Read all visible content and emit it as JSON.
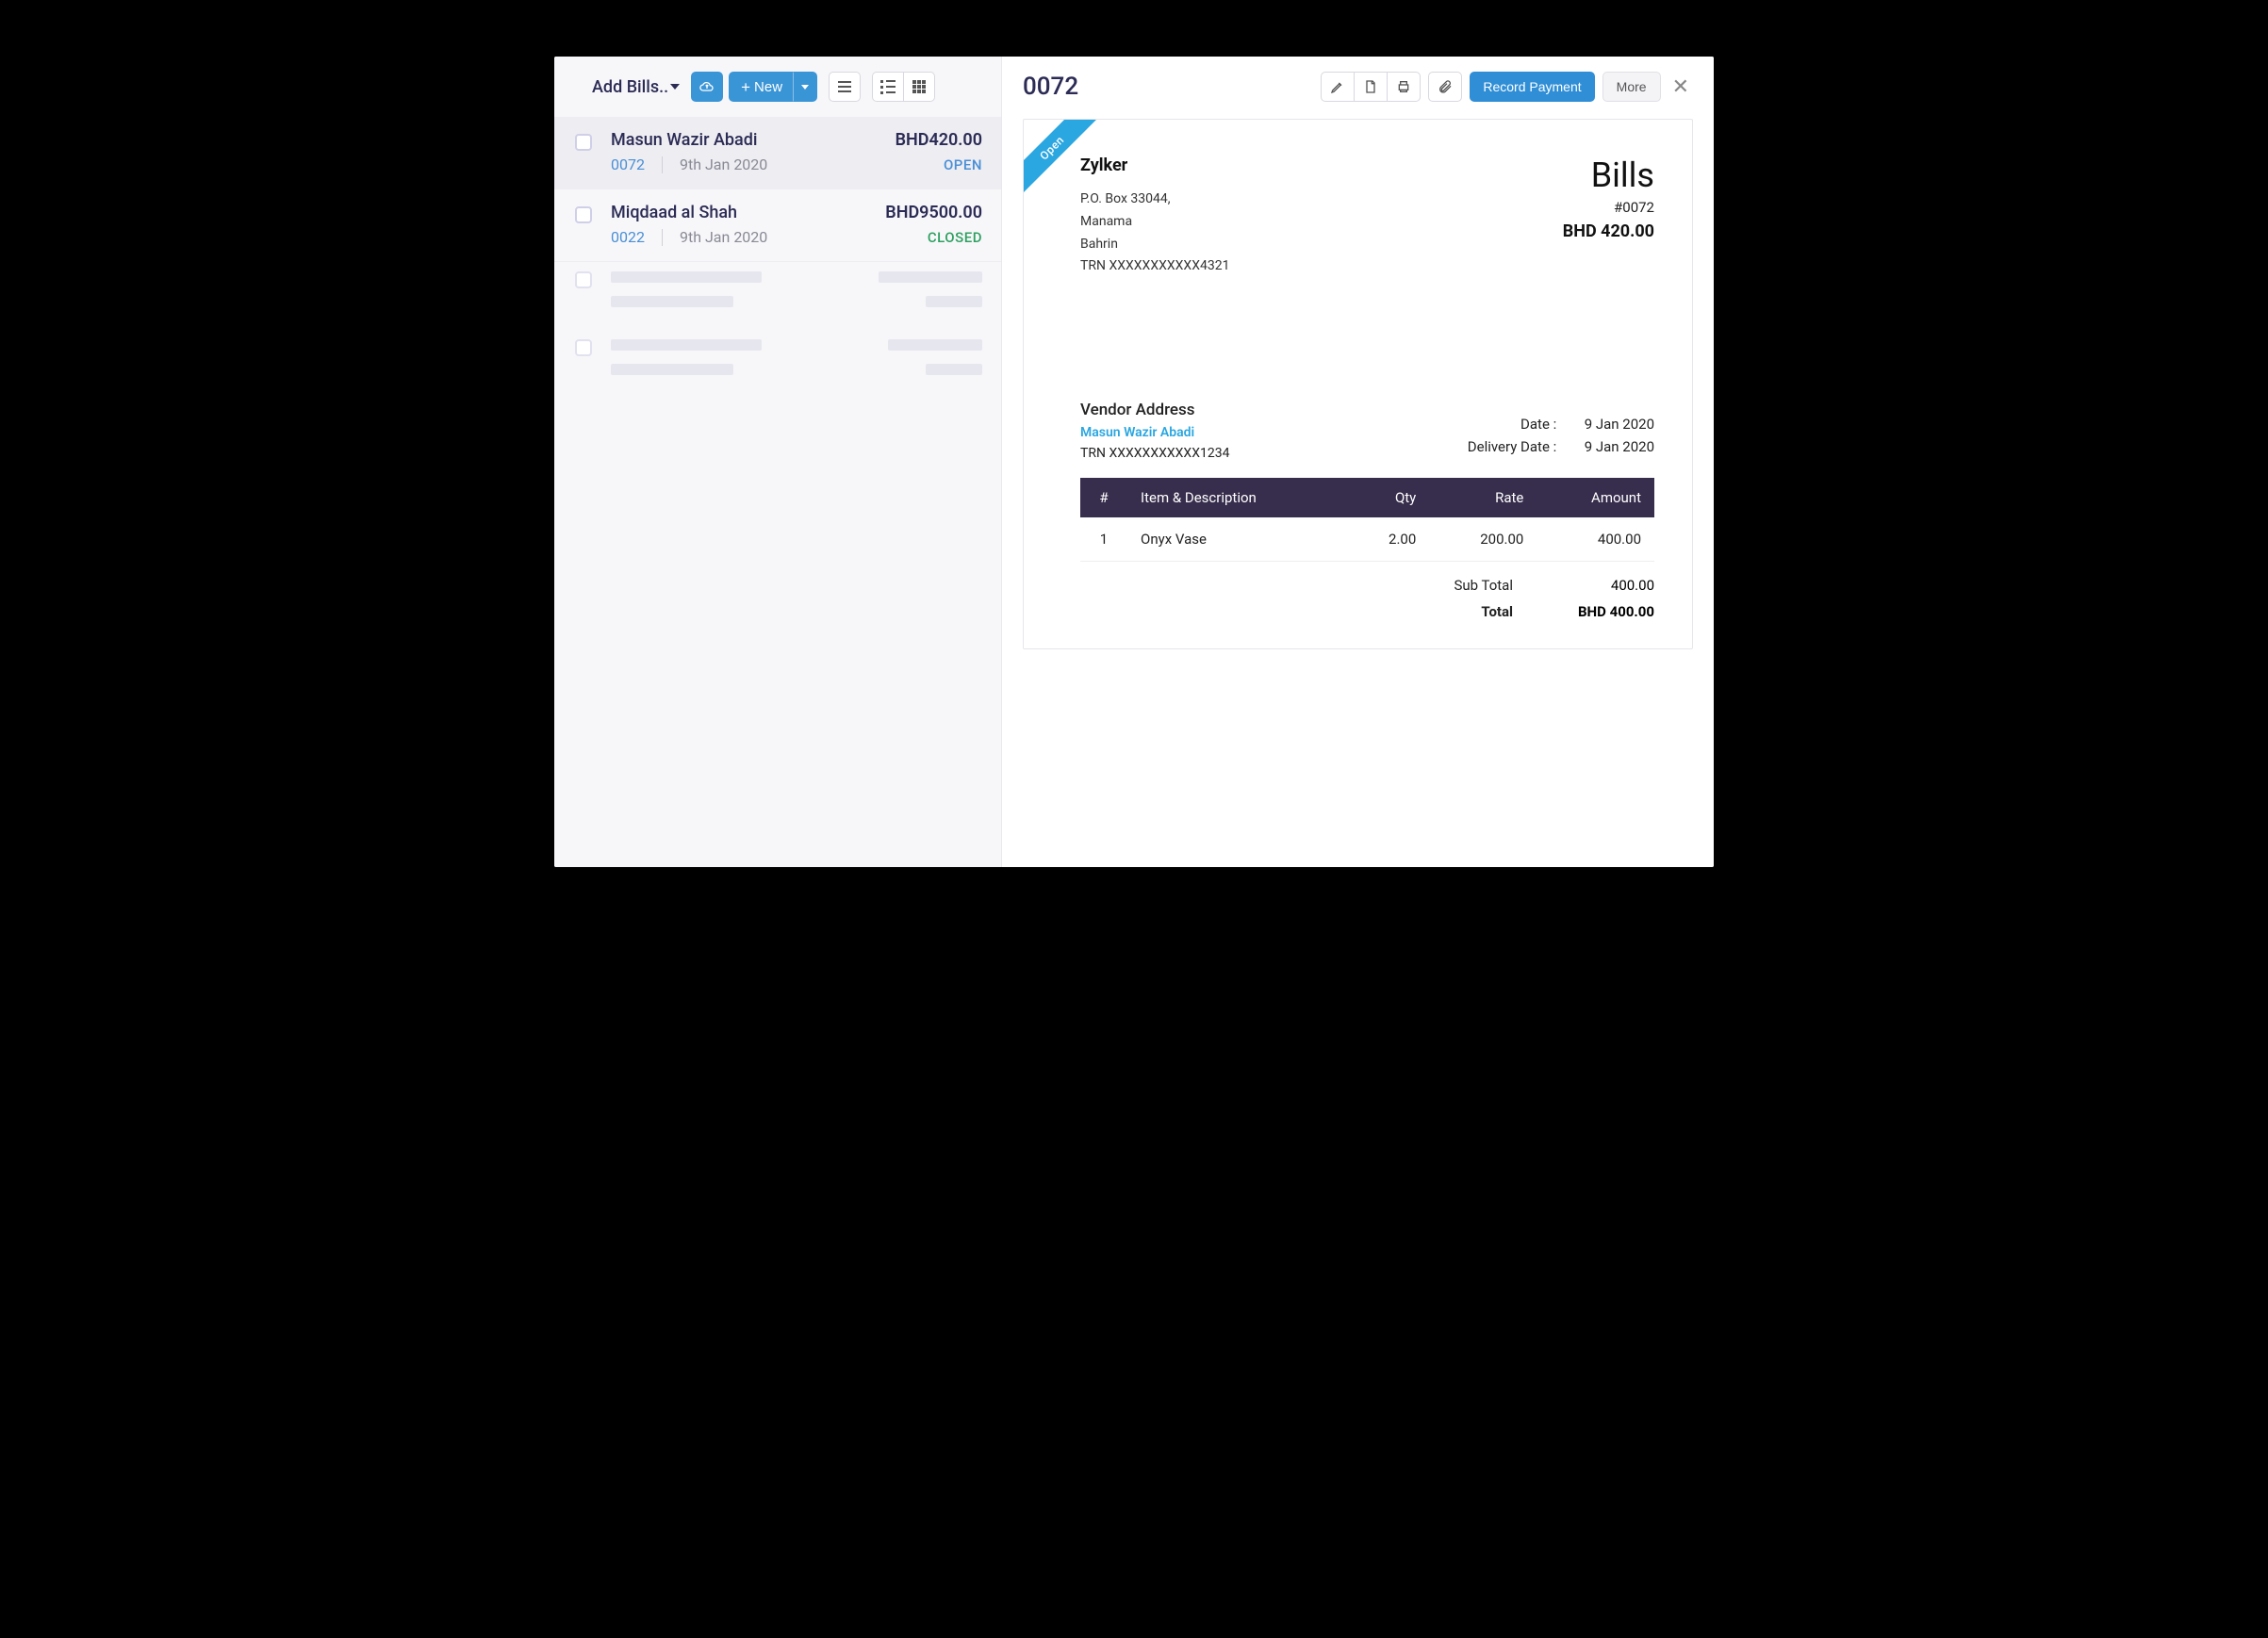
{
  "left": {
    "dropdown_label": "Add Bills..",
    "new_label": "New",
    "items": [
      {
        "name": "Masun Wazir Abadi",
        "amount": "BHD420.00",
        "bill_no": "0072",
        "date": "9th Jan 2020",
        "status": "OPEN",
        "status_class": "open"
      },
      {
        "name": "Miqdaad al Shah",
        "amount": "BHD9500.00",
        "bill_no": "0022",
        "date": "9th Jan 2020",
        "status": "CLOSED",
        "status_class": "closed"
      }
    ]
  },
  "right": {
    "title": "0072",
    "record_payment": "Record Payment",
    "more_label": "More"
  },
  "doc": {
    "ribbon": "Open",
    "company": "Zylker",
    "addr1": "P.O. Box 33044,",
    "addr2": "Manama",
    "addr3": "Bahrin",
    "trn": "TRN XXXXXXXXXXX4321",
    "bills_label": "Bills",
    "bills_no": "#0072",
    "bills_amount": "BHD 420.00",
    "vendor_heading": "Vendor Address",
    "vendor_name": "Masun Wazir Abadi",
    "vendor_trn": "TRN XXXXXXXXXXX1234",
    "date_label": "Date :",
    "date_value": "9 Jan 2020",
    "delivery_label": "Delivery Date :",
    "delivery_value": "9 Jan 2020",
    "th_num": "#",
    "th_item": "Item & Description",
    "th_qty": "Qty",
    "th_rate": "Rate",
    "th_amount": "Amount",
    "line_num": "1",
    "line_item": "Onyx Vase",
    "line_qty": "2.00",
    "line_rate": "200.00",
    "line_amount": "400.00",
    "subtotal_label": "Sub Total",
    "subtotal_value": "400.00",
    "total_label": "Total",
    "total_value": "BHD 400.00"
  }
}
